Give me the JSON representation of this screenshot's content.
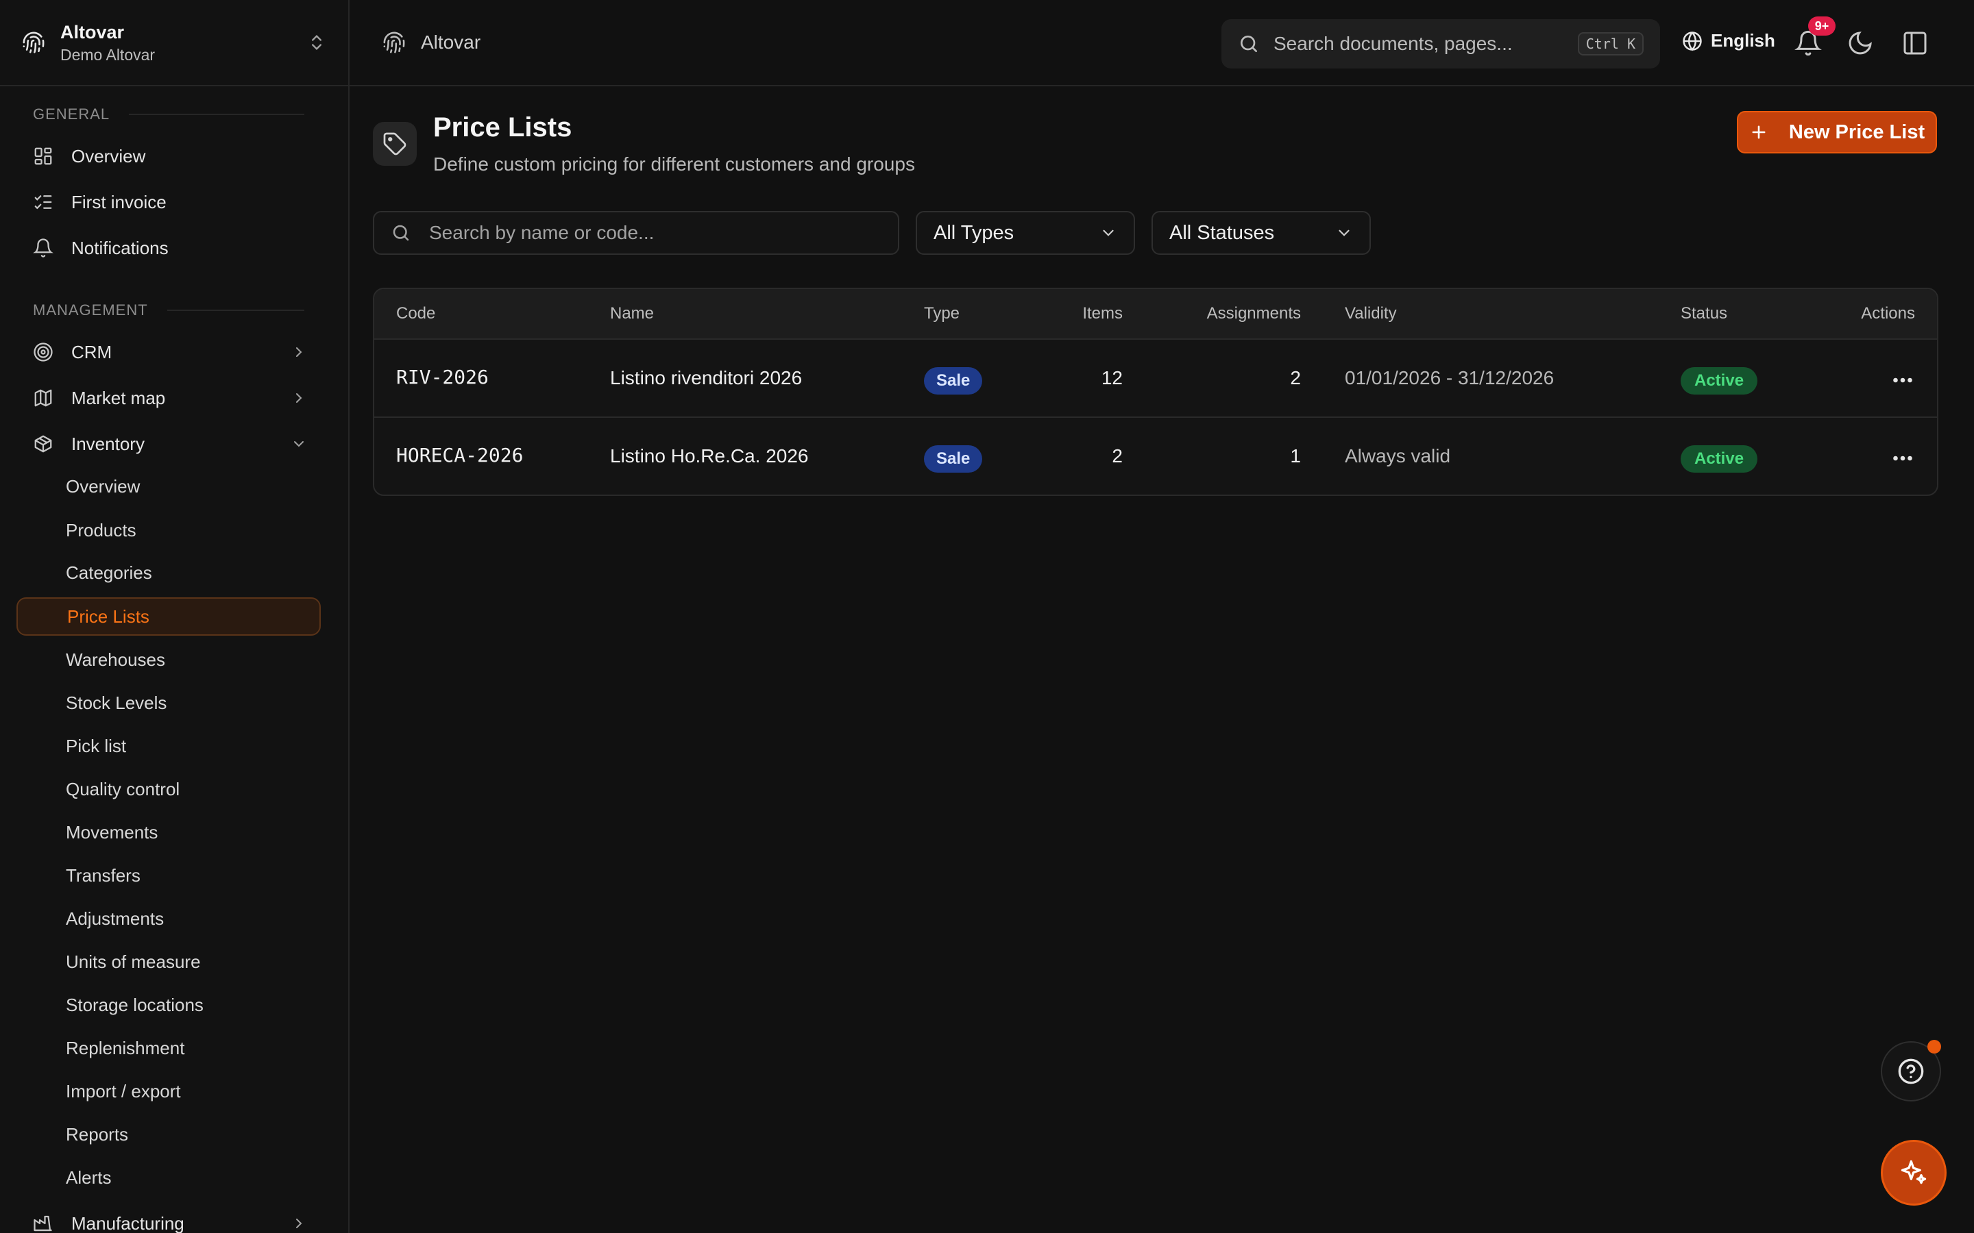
{
  "org": {
    "name": "Altovar",
    "subtitle": "Demo Altovar"
  },
  "sidebar": {
    "general_label": "GENERAL",
    "management_label": "MANAGEMENT",
    "general": [
      {
        "label": "Overview",
        "icon": "dashboard-icon"
      },
      {
        "label": "First invoice",
        "icon": "checklist-icon"
      },
      {
        "label": "Notifications",
        "icon": "bell-icon"
      }
    ],
    "management": [
      {
        "label": "CRM",
        "icon": "target-icon"
      },
      {
        "label": "Market map",
        "icon": "map-icon"
      },
      {
        "label": "Inventory",
        "icon": "box-icon"
      }
    ],
    "inventory_items": [
      "Overview",
      "Products",
      "Categories",
      "Price Lists",
      "Warehouses",
      "Stock Levels",
      "Pick list",
      "Quality control",
      "Movements",
      "Transfers",
      "Adjustments",
      "Units of measure",
      "Storage locations",
      "Replenishment",
      "Import / export",
      "Reports",
      "Alerts"
    ],
    "active_item": "Price Lists",
    "manufacturing": "Manufacturing"
  },
  "topbar": {
    "breadcrumb": "Altovar",
    "search_placeholder": "Search documents, pages...",
    "shortcut": "Ctrl K",
    "language": "English",
    "notification_badge": "9+"
  },
  "page": {
    "title": "Price Lists",
    "subtitle": "Define custom pricing for different customers and groups",
    "new_button": "New Price List",
    "search_placeholder": "Search by name or code...",
    "type_filter": "All Types",
    "status_filter": "All Statuses"
  },
  "table": {
    "headers": [
      "Code",
      "Name",
      "Type",
      "Items",
      "Assignments",
      "Validity",
      "Status",
      "Actions"
    ],
    "rows": [
      {
        "code": "RIV-2026",
        "name": "Listino rivenditori 2026",
        "type": "Sale",
        "items": "12",
        "assignments": "2",
        "validity": "01/01/2026 - 31/12/2026",
        "status": "Active"
      },
      {
        "code": "HORECA-2026",
        "name": "Listino Ho.Re.Ca. 2026",
        "type": "Sale",
        "items": "2",
        "assignments": "1",
        "validity": "Always valid",
        "status": "Active"
      }
    ]
  },
  "colors": {
    "accent": "#ea580c",
    "active_bg": "#14532d",
    "sale_bg": "#1e3a8a"
  }
}
